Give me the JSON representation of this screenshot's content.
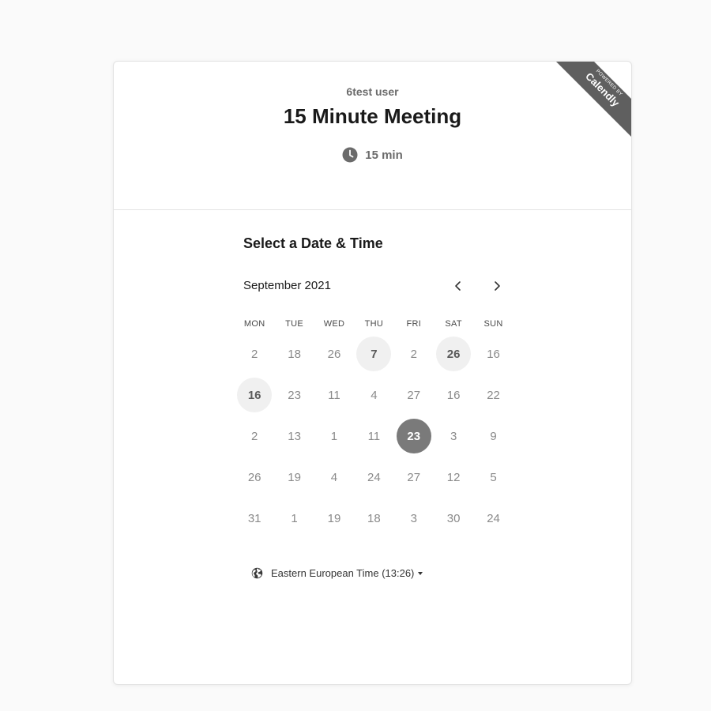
{
  "header": {
    "host_name": "6test user",
    "event_title": "15 Minute Meeting",
    "duration": "15 min",
    "duration_icon": "clock-icon"
  },
  "ribbon": {
    "powered_by": "POWERED BY",
    "brand": "Calendly"
  },
  "calendar": {
    "section_title": "Select a Date & Time",
    "month_label": "September 2021",
    "prev_icon": "chevron-left-icon",
    "next_icon": "chevron-right-icon",
    "weekdays": [
      "MON",
      "TUE",
      "WED",
      "THU",
      "FRI",
      "SAT",
      "SUN"
    ],
    "weeks": [
      [
        {
          "label": "2",
          "state": "unavailable"
        },
        {
          "label": "18",
          "state": "unavailable"
        },
        {
          "label": "26",
          "state": "unavailable"
        },
        {
          "label": "7",
          "state": "available"
        },
        {
          "label": "2",
          "state": "unavailable"
        },
        {
          "label": "26",
          "state": "available"
        },
        {
          "label": "16",
          "state": "unavailable"
        }
      ],
      [
        {
          "label": "16",
          "state": "available"
        },
        {
          "label": "23",
          "state": "unavailable"
        },
        {
          "label": "11",
          "state": "unavailable"
        },
        {
          "label": "4",
          "state": "unavailable"
        },
        {
          "label": "27",
          "state": "unavailable"
        },
        {
          "label": "16",
          "state": "unavailable"
        },
        {
          "label": "22",
          "state": "unavailable"
        }
      ],
      [
        {
          "label": "2",
          "state": "unavailable"
        },
        {
          "label": "13",
          "state": "unavailable"
        },
        {
          "label": "1",
          "state": "unavailable"
        },
        {
          "label": "11",
          "state": "unavailable"
        },
        {
          "label": "23",
          "state": "selected"
        },
        {
          "label": "3",
          "state": "unavailable"
        },
        {
          "label": "9",
          "state": "unavailable"
        }
      ],
      [
        {
          "label": "26",
          "state": "unavailable"
        },
        {
          "label": "19",
          "state": "unavailable"
        },
        {
          "label": "4",
          "state": "unavailable"
        },
        {
          "label": "24",
          "state": "unavailable"
        },
        {
          "label": "27",
          "state": "unavailable"
        },
        {
          "label": "12",
          "state": "unavailable"
        },
        {
          "label": "5",
          "state": "unavailable"
        }
      ],
      [
        {
          "label": "31",
          "state": "unavailable"
        },
        {
          "label": "1",
          "state": "unavailable"
        },
        {
          "label": "19",
          "state": "unavailable"
        },
        {
          "label": "18",
          "state": "unavailable"
        },
        {
          "label": "3",
          "state": "unavailable"
        },
        {
          "label": "30",
          "state": "unavailable"
        },
        {
          "label": "24",
          "state": "unavailable"
        }
      ]
    ]
  },
  "timezone": {
    "label": "Eastern European Time (13:26)",
    "icon": "globe-icon",
    "dropdown_icon": "caret-down-icon"
  },
  "colors": {
    "ribbon": "#5f5f5f",
    "selected_day": "#7a7a7a",
    "available_day": "#f0f0f0",
    "unavailable_text": "#8a8a8a"
  }
}
